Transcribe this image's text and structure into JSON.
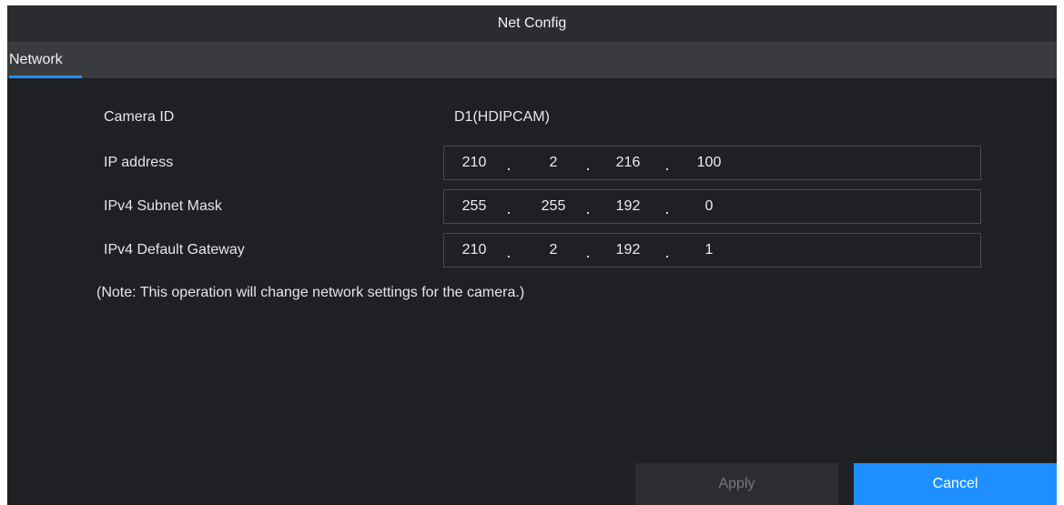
{
  "dialog": {
    "title": "Net Config"
  },
  "tabs": [
    {
      "label": "Network",
      "active": true
    }
  ],
  "fields": {
    "camera_id": {
      "label": "Camera ID",
      "value": "D1(HDIPCAM)"
    },
    "ip_address": {
      "label": "IP address",
      "octets": [
        "210",
        "2",
        "216",
        "100"
      ]
    },
    "subnet_mask": {
      "label": "IPv4 Subnet Mask",
      "octets": [
        "255",
        "255",
        "192",
        "0"
      ]
    },
    "default_gateway": {
      "label": "IPv4 Default Gateway",
      "octets": [
        "210",
        "2",
        "192",
        "1"
      ]
    }
  },
  "ip_separator": ".",
  "note": "(Note: This operation will change network settings for the camera.)",
  "buttons": {
    "apply_label": "Apply",
    "cancel_label": "Cancel"
  },
  "colors": {
    "accent": "#1e8fff",
    "background": "#1f2023",
    "disabled_button": "#2c2d31"
  }
}
